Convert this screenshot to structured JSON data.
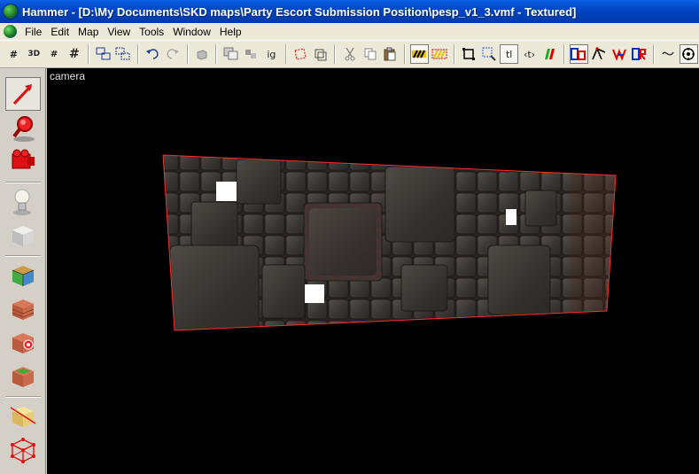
{
  "window": {
    "title": "Hammer - [D:\\My Documents\\SKD maps\\Party Escort Submission Position\\pesp_v1_3.vmf - Textured]"
  },
  "menu": {
    "items": [
      {
        "label": "File"
      },
      {
        "label": "Edit"
      },
      {
        "label": "Map"
      },
      {
        "label": "View"
      },
      {
        "label": "Tools"
      },
      {
        "label": "Window"
      },
      {
        "label": "Help"
      }
    ]
  },
  "toolbar": {
    "grid_label": "#",
    "grid3d_label": "3D",
    "grid_smaller_label": "#",
    "grid_larger_label": "#",
    "ignore_groups_label": "ig",
    "texture_lock_label": "tl",
    "scale_tex_label": "‹t›"
  },
  "viewport": {
    "label": "camera"
  },
  "colors": {
    "selection_outline": "#ff3030",
    "viewport_bg": "#000000",
    "title_bar": "#0044c4"
  }
}
